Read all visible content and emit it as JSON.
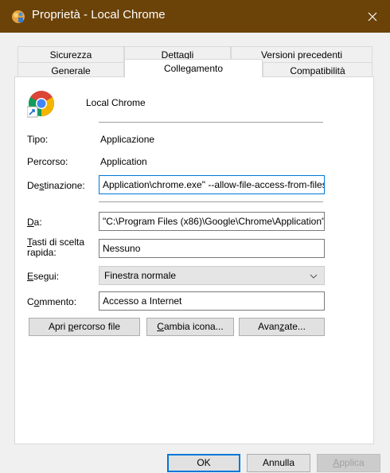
{
  "window": {
    "title": "Proprietà - Local Chrome",
    "close_label": "✕"
  },
  "tabs_row1": [
    {
      "label": "Sicurezza"
    },
    {
      "label": "Dettagli"
    },
    {
      "label": "Versioni precedenti"
    }
  ],
  "tabs_row2": [
    {
      "label": "Generale"
    },
    {
      "label": "Collegamento",
      "active": true
    },
    {
      "label": "Compatibilità"
    }
  ],
  "shortcut": {
    "name": "Local Chrome",
    "tipo_label": "Tipo:",
    "tipo_value": "Applicazione",
    "percorso_label": "Percorso:",
    "percorso_value": "Application",
    "destinazione_label_pre": "De",
    "destinazione_label_key": "s",
    "destinazione_label_post": "tinazione:",
    "destinazione_value": "Application\\chrome.exe\" --allow-file-access-from-files",
    "da_label_key": "D",
    "da_label_post": "a:",
    "da_value": "\"C:\\Program Files (x86)\\Google\\Chrome\\Application\"",
    "tasti_label_key": "T",
    "tasti_label_post": "asti di scelta",
    "tasti_label_line2": "rapida:",
    "tasti_value": "Nessuno",
    "esegui_label_key": "E",
    "esegui_label_post": "segui:",
    "esegui_value": "Finestra normale",
    "commento_label_pre": "C",
    "commento_label_key": "o",
    "commento_label_post": "mmento:",
    "commento_value": "Accesso a Internet"
  },
  "actions": {
    "apri_pre": "Apri ",
    "apri_key": "p",
    "apri_post": "ercorso file",
    "cambia_key": "C",
    "cambia_post": "ambia icona...",
    "avanzate_pre": "Avan",
    "avanzate_key": "z",
    "avanzate_post": "ate..."
  },
  "footer": {
    "ok": "OK",
    "annulla": "Annulla",
    "applica_key": "A",
    "applica_post": "pplica"
  },
  "colors": {
    "titlebar": "#6b4208",
    "focus": "#0078d7"
  }
}
